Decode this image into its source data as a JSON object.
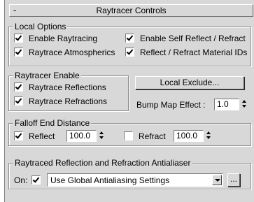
{
  "rollout": {
    "title": "Raytracer Controls",
    "collapse_symbol": "-"
  },
  "local_options": {
    "legend": "Local Options",
    "enable_raytracing": {
      "label": "Enable Raytracing",
      "checked": true
    },
    "enable_self_reflect": {
      "label": "Enable Self Reflect / Refract",
      "checked": true
    },
    "raytrace_atmospherics": {
      "label": "Raytrace Atmospherics",
      "checked": true
    },
    "reflect_refract_material_ids": {
      "label": "Reflect / Refract Material IDs",
      "checked": true
    }
  },
  "raytracer_enable": {
    "legend": "Raytracer Enable",
    "raytrace_reflections": {
      "label": "Raytrace Reflections",
      "checked": true
    },
    "raytrace_refractions": {
      "label": "Raytrace Refractions",
      "checked": true
    }
  },
  "local_exclude_button": "Local Exclude...",
  "bump_map_effect": {
    "label": "Bump Map Effect :",
    "value": "1.0"
  },
  "falloff": {
    "legend": "Falloff End Distance",
    "reflect": {
      "label": "Reflect",
      "checked": true,
      "value": "100.0"
    },
    "refract": {
      "label": "Refract",
      "checked": false,
      "value": "100.0"
    }
  },
  "antialiaser": {
    "legend": "Raytraced Reflection and Refraction Antialiaser",
    "on_label": "On:",
    "on_checked": true,
    "selected": "Use Global Antialiasing Settings",
    "more_button": "..."
  }
}
